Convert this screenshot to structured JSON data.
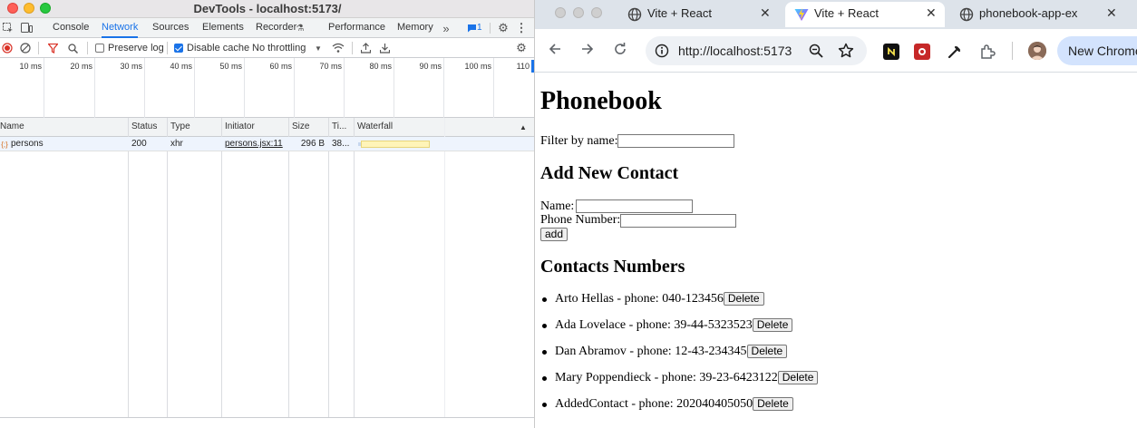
{
  "devtools": {
    "title": "DevTools - localhost:5173/",
    "tabs": [
      "Console",
      "Network",
      "Sources",
      "Elements",
      "Recorder",
      "Performance",
      "Memory"
    ],
    "active_tab": "Network",
    "issues_count": "1",
    "toolbar": {
      "preserve_log": "Preserve log",
      "preserve_log_checked": false,
      "disable_cache": "Disable cache",
      "disable_cache_checked": true,
      "throttling": "No throttling"
    },
    "overview_ticks": [
      "10 ms",
      "20 ms",
      "30 ms",
      "40 ms",
      "50 ms",
      "60 ms",
      "70 ms",
      "80 ms",
      "90 ms",
      "100 ms",
      "110"
    ],
    "columns": [
      "Name",
      "Status",
      "Type",
      "Initiator",
      "Size",
      "Ti...",
      "Waterfall"
    ],
    "rows": [
      {
        "name": "persons",
        "status": "200",
        "type": "xhr",
        "initiator": "persons.jsx:11",
        "size": "296 B",
        "time": "38..."
      }
    ]
  },
  "browser": {
    "tabs": [
      {
        "title": "Vite + React",
        "active": false
      },
      {
        "title": "Vite + React",
        "active": true
      },
      {
        "title": "phonebook-app-ex",
        "active": false
      }
    ],
    "url": "http://localhost:5173",
    "new_chrome_label": "New Chrome",
    "page": {
      "heading": "Phonebook",
      "filter_label": "Filter by name:",
      "add_heading": "Add New Contact",
      "name_label": "Name:",
      "phone_label": "Phone Number:",
      "add_button": "add",
      "contacts_heading": "Contacts Numbers",
      "delete_label": "Delete",
      "contacts": [
        "Arto Hellas - phone: 040-123456",
        "Ada Lovelace - phone: 39-44-5323523",
        "Dan Abramov - phone: 12-43-234345",
        "Mary Poppendieck - phone: 39-23-6423122",
        "AddedContact - phone: 202040405050"
      ]
    }
  }
}
